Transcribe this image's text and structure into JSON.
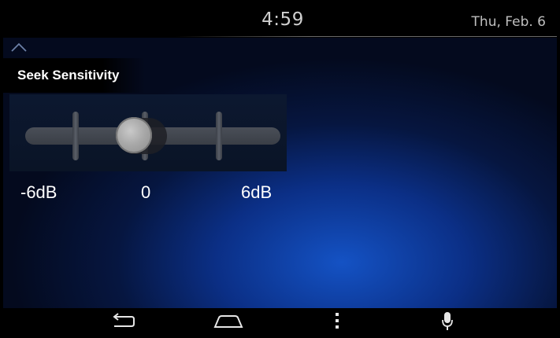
{
  "status_bar": {
    "time": "4:59",
    "date": "Thu, Feb. 6"
  },
  "section": {
    "title": "Seek Sensitivity"
  },
  "slider": {
    "min_label": "-6dB",
    "mid_label": "0",
    "max_label": "6dB",
    "value_fraction": 0.42
  },
  "nav": {
    "items": [
      "back-icon",
      "home-icon",
      "menu-icon",
      "microphone-icon"
    ]
  },
  "colors": {
    "background_accent": "#1452c4",
    "text": "#ffffff"
  }
}
